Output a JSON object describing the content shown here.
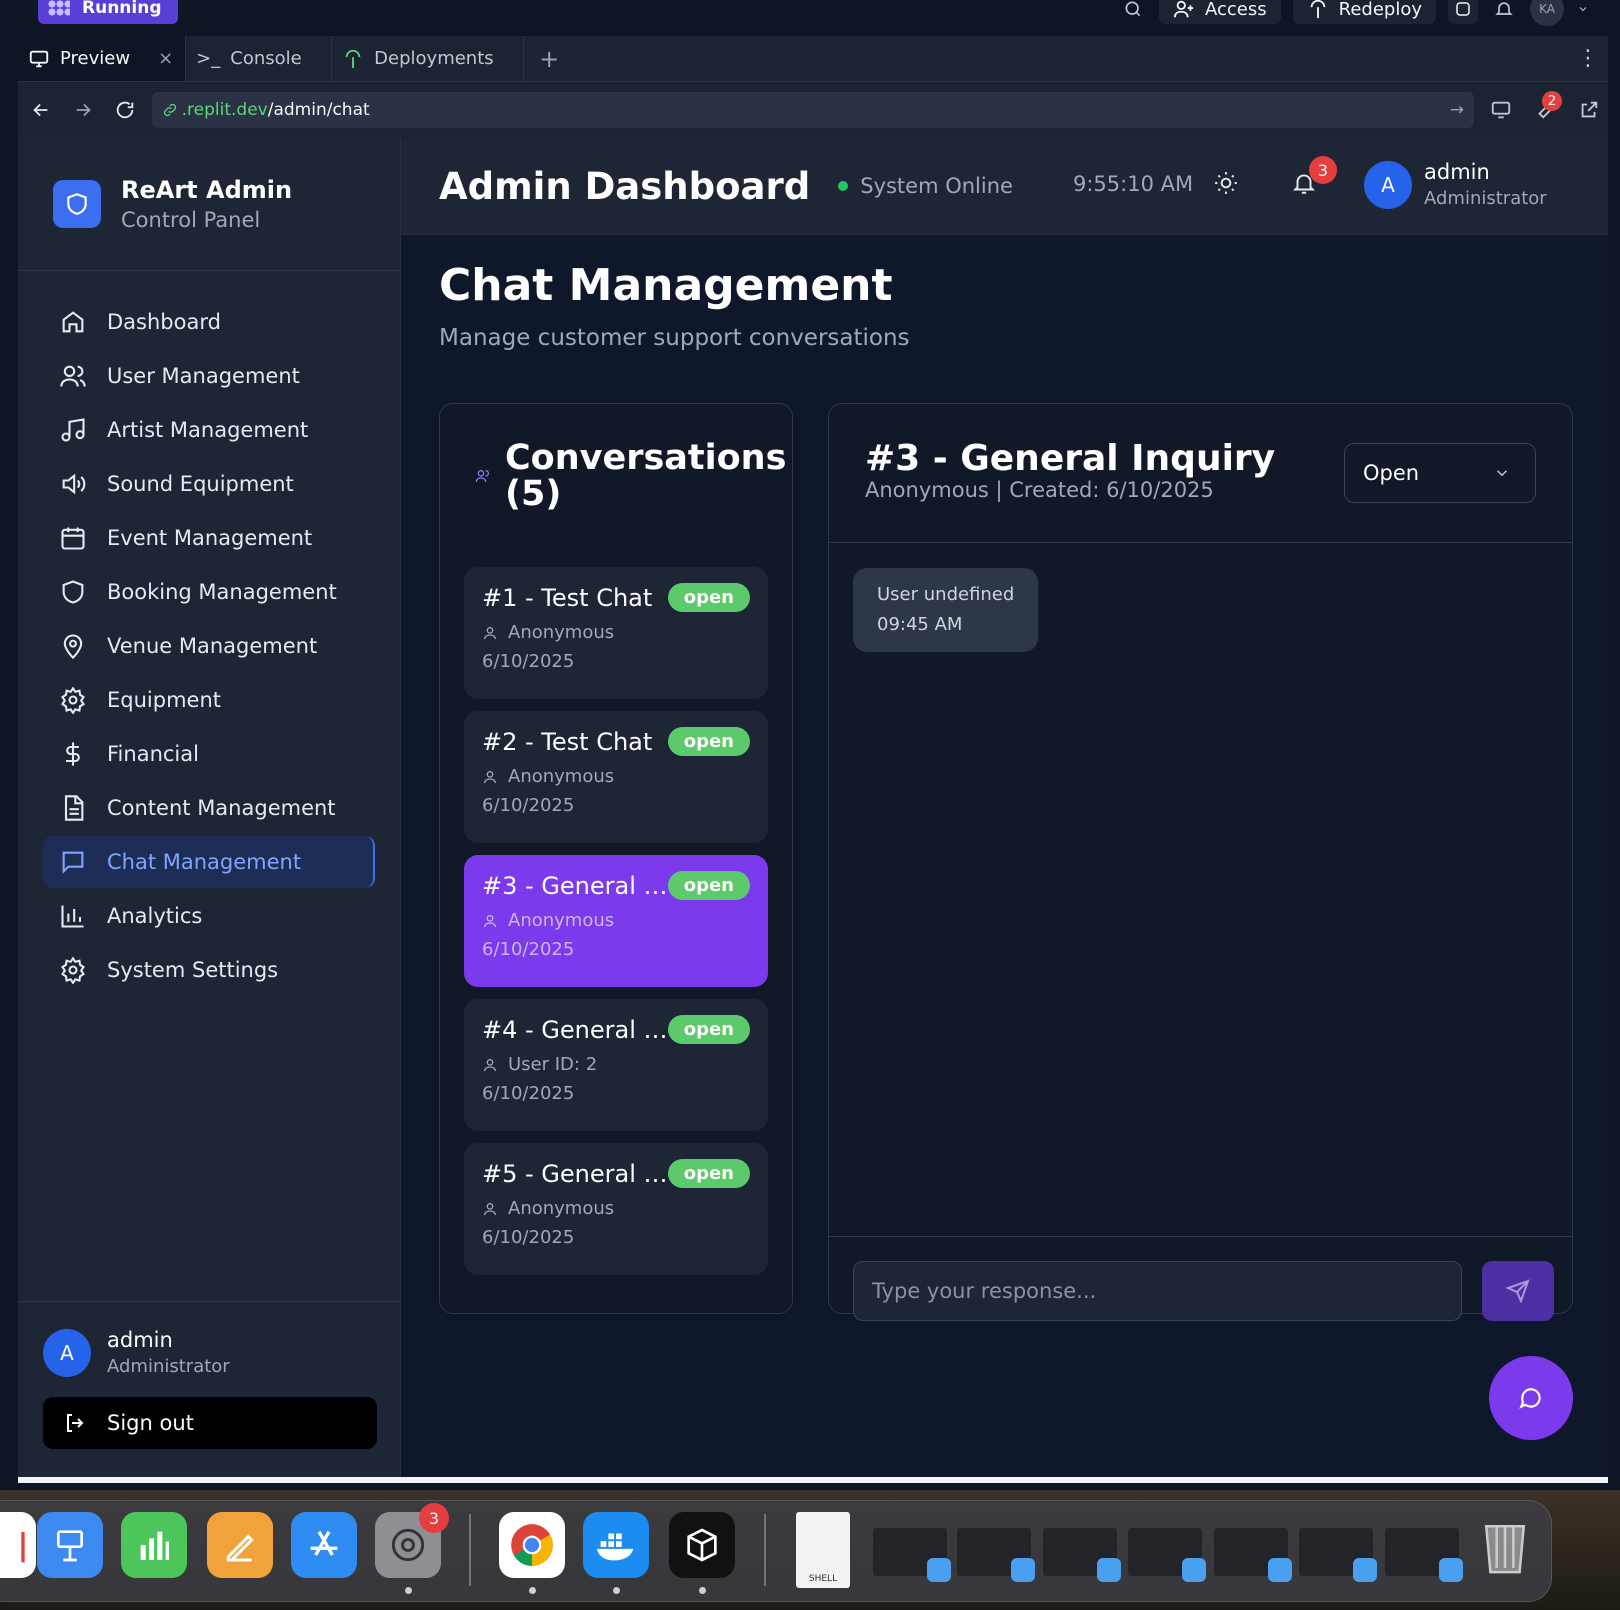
{
  "replit": {
    "run_label": "Running",
    "access_label": "Access",
    "redeploy_label": "Redeploy",
    "user_initials": "KA",
    "tabs": [
      {
        "label": "Preview",
        "active": true
      },
      {
        "label": "Console",
        "active": false
      },
      {
        "label": "Deployments",
        "active": false
      }
    ],
    "url_domain": ".replit.dev",
    "url_path": "/admin/chat",
    "devtools_badge": "2"
  },
  "sidebar": {
    "brand_title": "ReArt Admin",
    "brand_sub": "Control Panel",
    "items": [
      {
        "label": "Dashboard",
        "icon": "home-icon"
      },
      {
        "label": "User Management",
        "icon": "users-icon"
      },
      {
        "label": "Artist Management",
        "icon": "music-icon"
      },
      {
        "label": "Sound Equipment",
        "icon": "speaker-icon"
      },
      {
        "label": "Event Management",
        "icon": "calendar-icon"
      },
      {
        "label": "Booking Management",
        "icon": "shield-icon"
      },
      {
        "label": "Venue Management",
        "icon": "map-pin-icon"
      },
      {
        "label": "Equipment",
        "icon": "gear-icon"
      },
      {
        "label": "Financial",
        "icon": "dollar-icon"
      },
      {
        "label": "Content Management",
        "icon": "document-icon"
      },
      {
        "label": "Chat Management",
        "icon": "chat-icon",
        "active": true
      },
      {
        "label": "Analytics",
        "icon": "bar-chart-icon"
      },
      {
        "label": "System Settings",
        "icon": "gear-icon"
      }
    ],
    "user_initial": "A",
    "user_name": "admin",
    "user_role": "Administrator",
    "signout_label": "Sign out"
  },
  "header": {
    "title": "Admin Dashboard",
    "status": "System Online",
    "time": "9:55:10 AM",
    "notif_count": "3",
    "user_initial": "A",
    "user_name": "admin",
    "user_role": "Administrator"
  },
  "page": {
    "title": "Chat Management",
    "subtitle": "Manage customer support conversations"
  },
  "conversations": {
    "title": "Conversations (5)",
    "items": [
      {
        "title": "#1 - Test Chat",
        "status": "open",
        "user": "Anonymous",
        "date": "6/10/2025",
        "selected": false
      },
      {
        "title": "#2 - Test Chat",
        "status": "open",
        "user": "Anonymous",
        "date": "6/10/2025",
        "selected": false
      },
      {
        "title": "#3 - General I...",
        "status": "open",
        "user": "Anonymous",
        "date": "6/10/2025",
        "selected": true
      },
      {
        "title": "#4 - General I...",
        "status": "open",
        "user": "User ID: 2",
        "date": "6/10/2025",
        "selected": false
      },
      {
        "title": "#5 - General I...",
        "status": "open",
        "user": "Anonymous",
        "date": "6/10/2025",
        "selected": false
      }
    ]
  },
  "chat": {
    "title": "#3 - General Inquiry",
    "meta": "Anonymous | Created: 6/10/2025",
    "status_value": "Open",
    "message_sender": "User undefined",
    "message_time": "09:45 AM",
    "reply_placeholder": "Type your response..."
  },
  "dock": {
    "settings_badge": "3",
    "shell_label": "SHELL"
  },
  "colors": {
    "accent_purple": "#7c3aed",
    "accent_blue": "#3b6ff0",
    "status_green": "#22c55e",
    "badge_green": "#5cc96b",
    "notif_red": "#e53e3e"
  }
}
